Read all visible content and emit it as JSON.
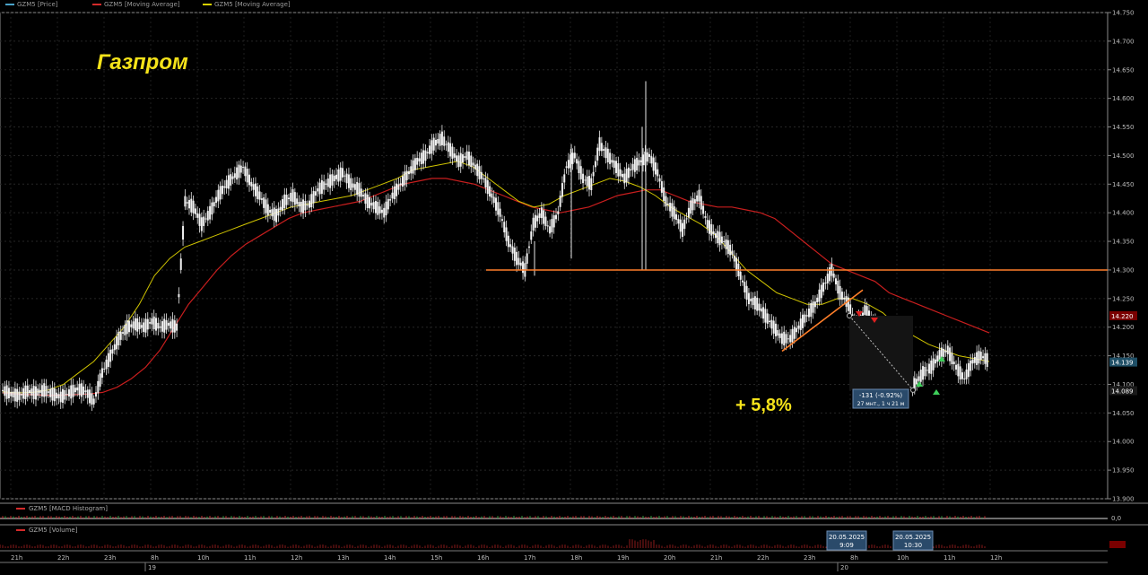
{
  "legend": [
    {
      "label": "GZM5 [Price]",
      "color": "#4aa3c8"
    },
    {
      "label": "GZM5 [Moving Average]",
      "color": "#d42a2a"
    },
    {
      "label": "GZM5 [Moving Average]",
      "color": "#d8d000"
    }
  ],
  "chart_data": {
    "type": "line",
    "title": "Газпром",
    "annotation": "+ 5,8%",
    "y_range": [
      13.9,
      14.75
    ],
    "y_ticks": [
      "14.750",
      "14.700",
      "14.650",
      "14.600",
      "14.550",
      "14.500",
      "14.450",
      "14.400",
      "14.350",
      "14.300",
      "14.250",
      "14.200",
      "14.150",
      "14.100",
      "14.050",
      "14.000",
      "13.950",
      "13.900"
    ],
    "price_labels": [
      {
        "value": 14.22,
        "text": "14.220",
        "color": "#7a0000"
      },
      {
        "value": 14.139,
        "text": "14.139",
        "color": "#1f4f66"
      },
      {
        "value": 14.089,
        "text": "14.089",
        "color": "#1a1a1a"
      }
    ],
    "resistance_level": 14.3,
    "x_ticks": [
      "21h",
      "22h",
      "23h",
      "8h",
      "10h",
      "11h",
      "12h",
      "13h",
      "14h",
      "15h",
      "16h",
      "17h",
      "18h",
      "19h",
      "20h",
      "21h",
      "22h",
      "23h",
      "8h",
      "10h",
      "11h",
      "12h"
    ],
    "day_labels": [
      "19",
      "20"
    ],
    "measure_box": {
      "line1": "-131 (-0.92%)",
      "line2": "27 мнт., 1 ч 21 м"
    },
    "time_flags": [
      {
        "date": "20.05.2025",
        "time": "9:09"
      },
      {
        "date": "20.05.2025",
        "time": "10:30"
      }
    ],
    "series": [
      {
        "name": "GZM5 [Price]",
        "values": [
          14.09,
          14.083,
          14.08,
          14.088,
          14.085,
          14.09,
          14.083,
          14.078,
          14.085,
          14.092,
          14.088,
          14.07,
          14.12,
          14.15,
          14.18,
          14.2,
          14.205,
          14.2,
          14.21,
          14.2,
          14.205,
          14.2,
          14.42,
          14.41,
          14.38,
          14.4,
          14.43,
          14.45,
          14.465,
          14.48,
          14.45,
          14.43,
          14.405,
          14.395,
          14.42,
          14.43,
          14.41,
          14.415,
          14.44,
          14.45,
          14.46,
          14.47,
          14.45,
          14.44,
          14.42,
          14.41,
          14.4,
          14.43,
          14.45,
          14.47,
          14.49,
          14.5,
          14.52,
          14.53,
          14.51,
          14.49,
          14.5,
          14.48,
          14.46,
          14.43,
          14.4,
          14.35,
          14.32,
          14.3,
          14.38,
          14.4,
          14.37,
          14.4,
          14.48,
          14.5,
          14.46,
          14.45,
          14.52,
          14.5,
          14.48,
          14.46,
          14.48,
          14.49,
          14.5,
          14.47,
          14.42,
          14.4,
          14.37,
          14.41,
          14.43,
          14.38,
          14.36,
          14.35,
          14.33,
          14.29,
          14.25,
          14.24,
          14.22,
          14.2,
          14.18,
          14.18,
          14.2,
          14.22,
          14.24,
          14.27,
          14.3,
          14.26,
          14.24,
          14.2,
          14.23,
          14.21,
          14.18,
          14.14,
          14.12,
          14.11,
          14.1,
          14.12,
          14.13,
          14.15,
          14.16,
          14.13,
          14.11,
          14.14,
          14.15,
          14.14
        ]
      },
      {
        "name": "GZM5 [Moving Average]",
        "values": [
          14.085,
          14.083,
          14.082,
          14.081,
          14.081,
          14.082,
          14.083,
          14.086,
          14.095,
          14.11,
          14.13,
          14.16,
          14.2,
          14.24,
          14.27,
          14.3,
          14.325,
          14.345,
          14.36,
          14.375,
          14.39,
          14.4,
          14.405,
          14.41,
          14.415,
          14.42,
          14.43,
          14.44,
          14.45,
          14.455,
          14.46,
          14.46,
          14.455,
          14.45,
          14.44,
          14.43,
          14.42,
          14.41,
          14.405,
          14.4,
          14.405,
          14.41,
          14.42,
          14.43,
          14.435,
          14.44,
          14.44,
          14.43,
          14.42,
          14.415,
          14.41,
          14.41,
          14.405,
          14.4,
          14.39,
          14.37,
          14.35,
          14.33,
          14.31,
          14.3,
          14.29,
          14.28,
          14.26,
          14.25,
          14.24,
          14.23,
          14.22,
          14.21,
          14.2,
          14.19
        ]
      },
      {
        "name": "GZM5 [Moving Average]",
        "values": [
          14.087,
          14.085,
          14.086,
          14.09,
          14.1,
          14.12,
          14.14,
          14.17,
          14.2,
          14.24,
          14.29,
          14.32,
          14.34,
          14.35,
          14.36,
          14.37,
          14.38,
          14.39,
          14.4,
          14.41,
          14.415,
          14.42,
          14.425,
          14.43,
          14.44,
          14.45,
          14.46,
          14.475,
          14.48,
          14.485,
          14.49,
          14.48,
          14.46,
          14.44,
          14.42,
          14.41,
          14.415,
          14.43,
          14.44,
          14.45,
          14.46,
          14.455,
          14.445,
          14.43,
          14.41,
          14.395,
          14.38,
          14.36,
          14.33,
          14.3,
          14.28,
          14.26,
          14.25,
          14.24,
          14.24,
          14.25,
          14.25,
          14.24,
          14.225,
          14.2,
          14.185,
          14.17,
          14.16,
          14.15,
          14.145,
          14.14
        ]
      }
    ]
  }
}
